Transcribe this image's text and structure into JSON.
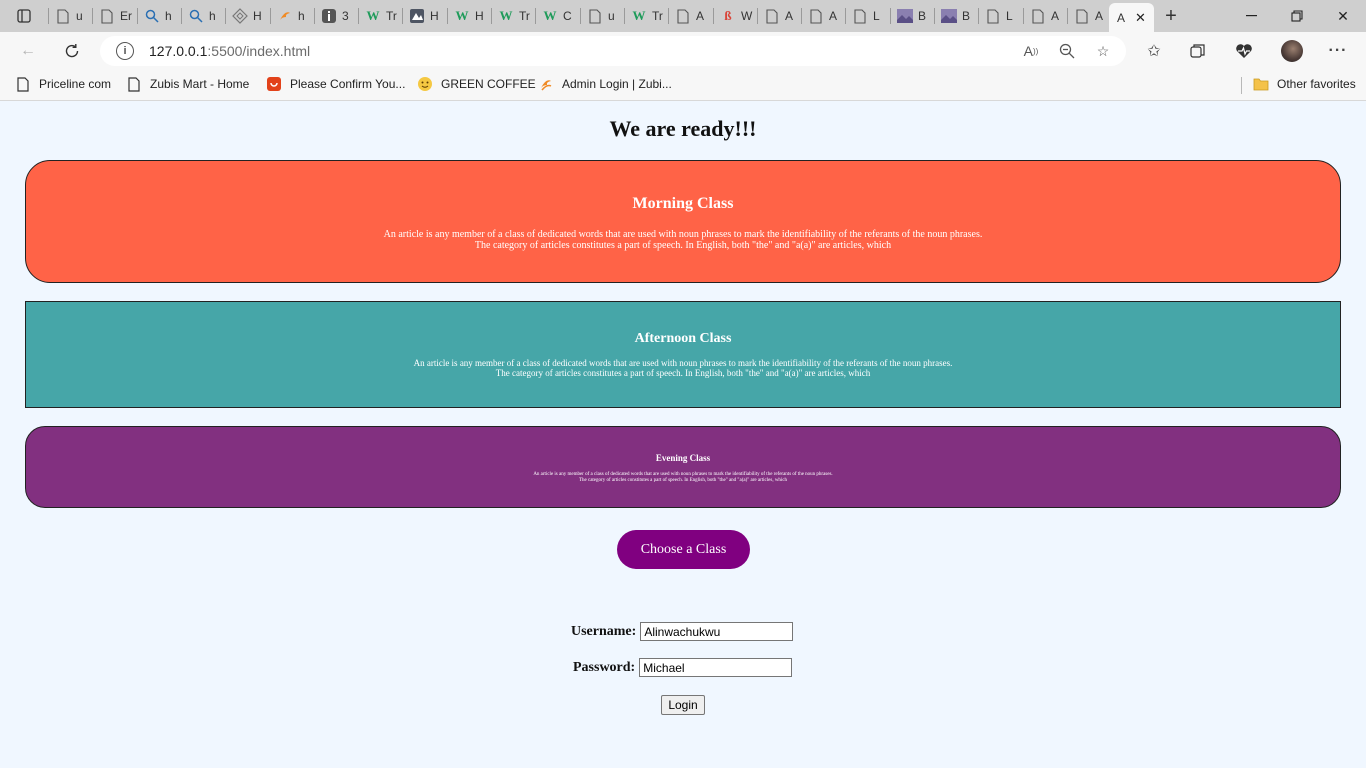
{
  "browser": {
    "tabs": [
      {
        "title": "u",
        "icon": "page-icon"
      },
      {
        "title": "Er",
        "icon": "page-icon"
      },
      {
        "title": "h",
        "icon": "search-icon"
      },
      {
        "title": "h",
        "icon": "search-icon"
      },
      {
        "title": "H",
        "icon": "diamond-icon"
      },
      {
        "title": "h",
        "icon": "flame-icon"
      },
      {
        "title": "3",
        "icon": "info-icon"
      },
      {
        "title": "Tr",
        "icon": "w-icon"
      },
      {
        "title": "H",
        "icon": "mountain-icon"
      },
      {
        "title": "H",
        "icon": "w-icon"
      },
      {
        "title": "Tr",
        "icon": "w-icon"
      },
      {
        "title": "C",
        "icon": "w-icon"
      },
      {
        "title": "u",
        "icon": "page-icon"
      },
      {
        "title": "Tr",
        "icon": "w-icon"
      },
      {
        "title": "A",
        "icon": "page-icon"
      },
      {
        "title": "W",
        "icon": "b-icon"
      },
      {
        "title": "A",
        "icon": "page-icon"
      },
      {
        "title": "A",
        "icon": "page-icon"
      },
      {
        "title": "L",
        "icon": "page-icon"
      },
      {
        "title": "B",
        "icon": "image-icon"
      },
      {
        "title": "B",
        "icon": "image-icon"
      },
      {
        "title": "L",
        "icon": "page-icon"
      },
      {
        "title": "A",
        "icon": "page-icon"
      },
      {
        "title": "A",
        "icon": "page-icon"
      }
    ],
    "active_tab": {
      "title": "A"
    },
    "url_host": "127.0.0.1",
    "url_rest": ":5500/index.html",
    "favorites": [
      {
        "label": "Priceline com",
        "icon": "page-icon"
      },
      {
        "label": "Zubis Mart - Home",
        "icon": "page-icon"
      },
      {
        "label": "Please Confirm You...",
        "icon": "shop-icon"
      },
      {
        "label": "GREEN COFFEE",
        "icon": "smiley-icon"
      },
      {
        "label": "Admin Login | Zubi...",
        "icon": "flame-icon"
      }
    ],
    "other_favorites": "Other favorites"
  },
  "page": {
    "title": "We are ready!!!",
    "classes": [
      {
        "name": "Morning Class",
        "line1": "An article is any member of a class of dedicated words that are used with noun phrases to mark the identifiability of the referants of the noun phrases.",
        "line2": "The category of articles constitutes a part of speech. In English, both \"the\" and \"a(a)\" are articles, which",
        "color": "#ff6347"
      },
      {
        "name": "Afternoon Class",
        "line1": "An article is any member of a class of dedicated words that are used with noun phrases to mark the identifiability of the referants of the noun phrases.",
        "line2": "The category of articles constitutes a part of speech. In English, both \"the\" and \"a(a)\" are articles, which",
        "color": "#46a6a8"
      },
      {
        "name": "Evening Class",
        "line1": "An article is any member of a class of dedicated words that are used with noun phrases to mark the identifiability of the referants of the noun phrases.",
        "line2": "The category of articles constitutes a part of speech. In English, both \"the\" and \"a(a)\" are articles, which",
        "color": "#823080"
      }
    ],
    "choose_button": "Choose a Class",
    "username_label": "Username:",
    "username_value": "Alinwachukwu",
    "password_label": "Password:",
    "password_value": "Michael",
    "login_button": "Login"
  }
}
